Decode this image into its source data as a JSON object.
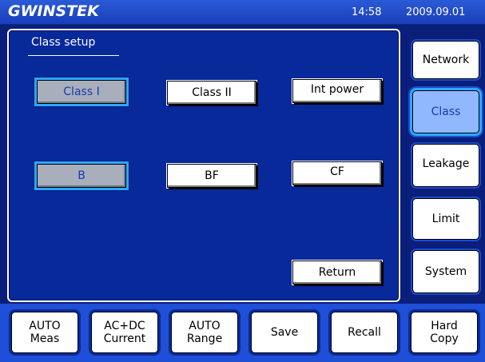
{
  "header": {
    "brand": "GWINSTEK",
    "time": "14:58",
    "date": "2009.09.01"
  },
  "panel": {
    "title": "Class setup",
    "buttons": {
      "class_1": "Class I",
      "class_2": "Class II",
      "int_power": "Int power",
      "b": "B",
      "bf": "BF",
      "cf": "CF",
      "return": "Return"
    }
  },
  "side_menu": {
    "network": "Network",
    "class": "Class",
    "leakage": "Leakage",
    "limit": "Limit",
    "system": "System"
  },
  "bottom_menu": {
    "auto_meas": "AUTO\nMeas",
    "acdc_current": "AC+DC\nCurrent",
    "auto_range": "AUTO\nRange",
    "save": "Save",
    "recall": "Recall",
    "hard_copy": "Hard\nCopy"
  },
  "colors": {
    "background": "#0a1e7a",
    "panel": "#07299a",
    "selected_highlight": "#2fa7ff"
  }
}
